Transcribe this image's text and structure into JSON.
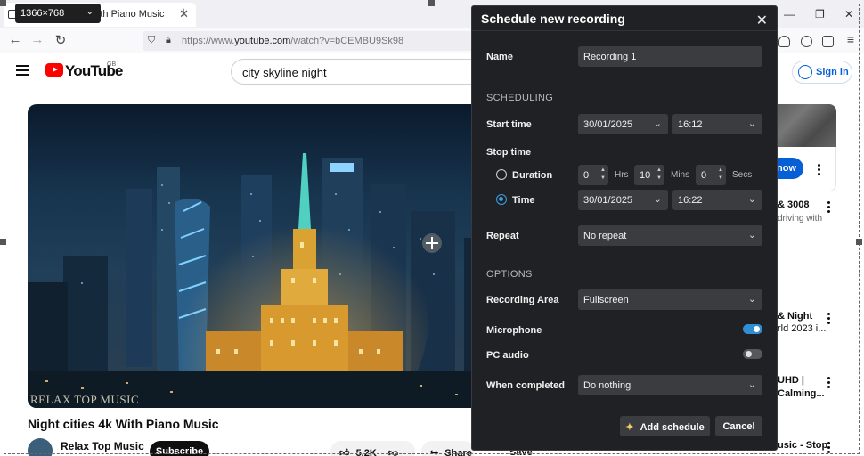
{
  "browser": {
    "tab_title": "Night cities 4k With Piano Music",
    "tab_close": "✕",
    "new_tab": "+",
    "url_prefix": "https://www.",
    "url_domain": "youtube.com",
    "url_rest": "/watch?v=bCEMBU9Sk98",
    "win_minimize": "—",
    "win_restore": "❐",
    "win_close": "✕"
  },
  "resolution_badge": {
    "label": "1366×768",
    "chevron": "⌄"
  },
  "youtube": {
    "logo_text": "YouTube",
    "country": "GB",
    "search_query": "city skyline night",
    "signin_label": "Sign in",
    "video_title": "Night cities 4k With Piano Music",
    "watermark": "RELAX TOP MUSIC",
    "channel_name": "Relax Top Music",
    "subscribe_label": "Subscribe",
    "likes": "5.2K",
    "share_label": "Share",
    "save_label": "Save",
    "sidebar": {
      "cta_label": "now",
      "items": [
        {
          "line1": "& 3008",
          "line2": "driving with"
        },
        {
          "line1": "& Night",
          "line2": "rld 2023 i..."
        },
        {
          "line1": "UHD |",
          "line2": "Calming..."
        },
        {
          "line1": "usic - Stop",
          "line2": ""
        }
      ]
    }
  },
  "dialog": {
    "title": "Schedule new recording",
    "close": "✕",
    "name_label": "Name",
    "name_value": "Recording 1",
    "scheduling_header": "SCHEDULING",
    "start_time_label": "Start time",
    "start_date": "30/01/2025",
    "start_time": "16:12",
    "stop_time_label": "Stop time",
    "duration_label": "Duration",
    "duration": {
      "hrs": "0",
      "mins": "10",
      "secs": "0",
      "hrs_unit": "Hrs",
      "mins_unit": "Mins",
      "secs_unit": "Secs"
    },
    "time_label": "Time",
    "stop_date": "30/01/2025",
    "stop_time": "16:22",
    "stop_mode": "time",
    "repeat_label": "Repeat",
    "repeat_value": "No repeat",
    "options_header": "OPTIONS",
    "recording_area_label": "Recording Area",
    "recording_area_value": "Fullscreen",
    "microphone_label": "Microphone",
    "microphone_on": true,
    "pc_audio_label": "PC audio",
    "pc_audio_on": false,
    "when_completed_label": "When completed",
    "when_completed_value": "Do nothing",
    "add_schedule_label": "Add schedule",
    "cancel_label": "Cancel"
  },
  "colors": {
    "dialog_bg": "#202124",
    "field_bg": "#3b3c40",
    "accent": "#2f8fd2",
    "youtube_red": "#ff0000",
    "link_blue": "#065fd4"
  }
}
